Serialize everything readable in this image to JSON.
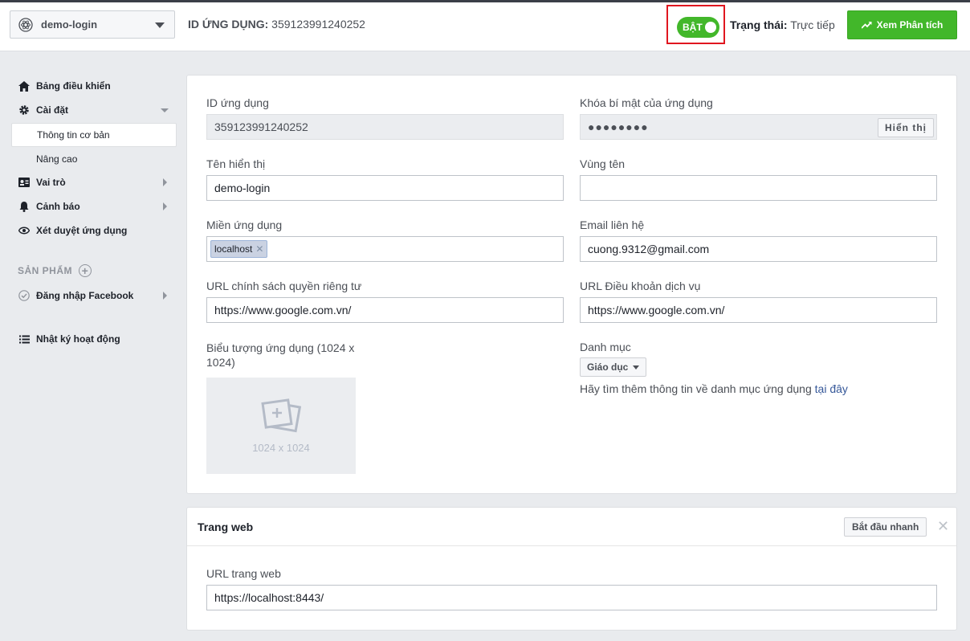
{
  "header": {
    "app_name": "demo-login",
    "app_id_label": "ID ỨNG DỤNG:",
    "app_id_value": "359123991240252",
    "toggle_label": "BẬT",
    "status_label": "Trạng thái:",
    "status_value": "Trực tiếp",
    "analytics_button": "Xem Phân tích"
  },
  "sidebar": {
    "items": [
      {
        "label": "Bảng điều khiển",
        "icon": "home-icon"
      },
      {
        "label": "Cài đặt",
        "icon": "gear-icon"
      },
      {
        "label": "Thông tin cơ bản"
      },
      {
        "label": "Nâng cao"
      },
      {
        "label": "Vai trò",
        "icon": "id-card-icon"
      },
      {
        "label": "Cảnh báo",
        "icon": "bell-icon"
      },
      {
        "label": "Xét duyệt ứng dụng",
        "icon": "eye-icon"
      }
    ],
    "products_label": "SẢN PHẨM",
    "product_items": [
      {
        "label": "Đăng nhập Facebook",
        "icon": "check-circle-icon"
      }
    ],
    "activity_log": {
      "label": "Nhật ký hoạt động",
      "icon": "list-icon"
    }
  },
  "basic": {
    "app_id_label": "ID ứng dụng",
    "app_id_value": "359123991240252",
    "secret_label": "Khóa bí mật của ứng dụng",
    "secret_value": "●●●●●●●●",
    "show_button": "Hiển thị",
    "display_name_label": "Tên hiển thị",
    "display_name_value": "demo-login",
    "namespace_label": "Vùng tên",
    "namespace_value": "",
    "domains_label": "Miền ứng dụng",
    "domain_token": "localhost",
    "email_label": "Email liên hệ",
    "email_value": "cuong.9312@gmail.com",
    "privacy_label": "URL chính sách quyền riêng tư",
    "privacy_value": "https://www.google.com.vn/",
    "terms_label": "URL Điều khoản dịch vụ",
    "terms_value": "https://www.google.com.vn/",
    "icon_label_line1": "Biểu tượng ứng dụng (1024 x",
    "icon_label_line2": "1024)",
    "icon_size": "1024 x 1024",
    "category_label": "Danh mục",
    "category_value": "Giáo dục",
    "category_help": "Hãy tìm thêm thông tin về danh mục ứng dụng",
    "category_help_link": "tại đây"
  },
  "website": {
    "title": "Trang web",
    "quick_start": "Bắt đầu nhanh",
    "url_label": "URL trang web",
    "url_value": "https://localhost:8443/"
  },
  "colors": {
    "accent_green": "#42b72a",
    "highlight_red": "#e0161f",
    "link_blue": "#365899"
  }
}
